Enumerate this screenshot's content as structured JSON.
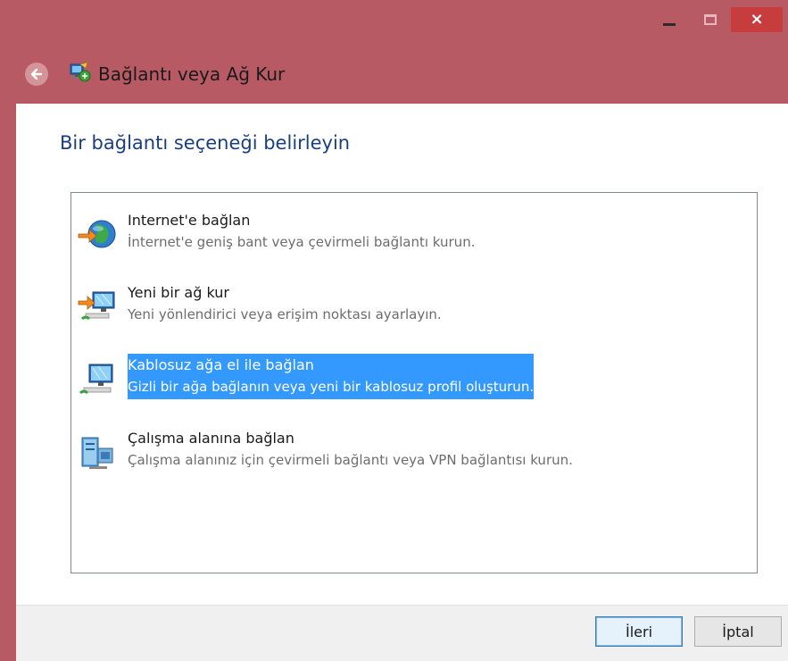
{
  "window": {
    "title": "Bağlantı veya Ağ Kur",
    "controls": {
      "minimize": "minimize",
      "maximize": "maximize",
      "close": "×"
    },
    "frame_color": "#b85a64"
  },
  "main": {
    "heading": "Bir bağlantı seçeneği belirleyin",
    "options": [
      {
        "title": "Internet'e bağlan",
        "description": "İnternet'e geniş bant veya çevirmeli bağlantı kurun.",
        "icon": "globe-arrow-icon",
        "selected": false
      },
      {
        "title": "Yeni bir ağ kur",
        "description": "Yeni yönlendirici veya erişim noktası ayarlayın.",
        "icon": "network-setup-icon",
        "selected": false
      },
      {
        "title": "Kablosuz ağa el ile bağlan",
        "description": "Gizli bir ağa bağlanın veya yeni bir kablosuz profil oluşturun.",
        "icon": "wireless-computer-icon",
        "selected": true
      },
      {
        "title": "Çalışma alanına bağlan",
        "description": "Çalışma alanınız için çevirmeli bağlantı veya VPN bağlantısı kurun.",
        "icon": "workplace-server-icon",
        "selected": false
      }
    ]
  },
  "footer": {
    "next_label": "İleri",
    "cancel_label": "İptal"
  },
  "colors": {
    "heading": "#1a3e86",
    "selection": "#3399ff",
    "close_button": "#c73d3d"
  }
}
